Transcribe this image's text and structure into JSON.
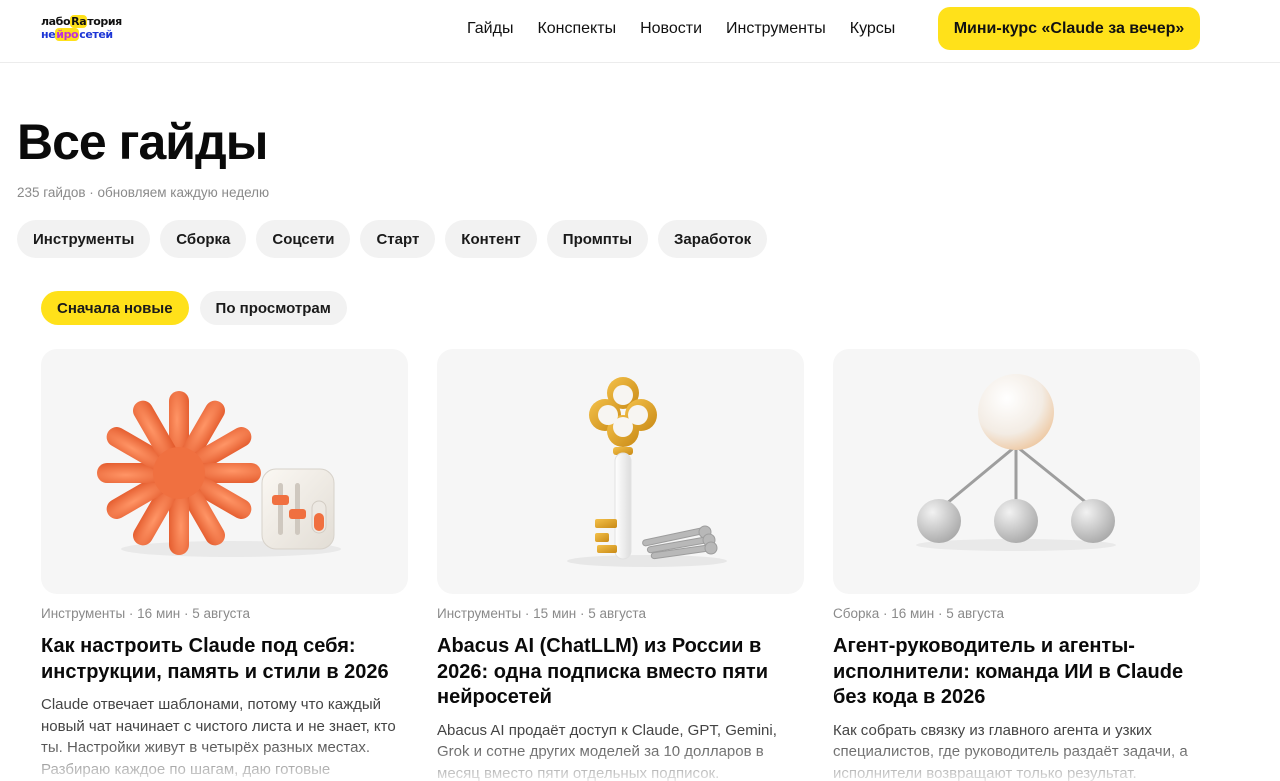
{
  "logo": {
    "line1_a": "лабо",
    "line1_b": "Ra",
    "line1_c": "тория",
    "line2_a": "не",
    "line2_b": "йро",
    "line2_c": "сетей"
  },
  "nav": {
    "items": [
      "Гайды",
      "Конспекты",
      "Новости",
      "Инструменты",
      "Курсы"
    ],
    "cta": "Мини-курс «Claude за вечер»"
  },
  "page": {
    "title": "Все гайды",
    "subtitle": "235 гайдов · обновляем каждую неделю"
  },
  "categories": [
    "Инструменты",
    "Сборка",
    "Соцсети",
    "Старт",
    "Контент",
    "Промпты",
    "Заработок"
  ],
  "sort": {
    "options": [
      "Сначала новые",
      "По просмотрам"
    ],
    "active": "Сначала новые"
  },
  "colors": {
    "accent": "#ffe11a",
    "orange": "#f0713f",
    "gold": "#e2a325"
  },
  "cards": [
    {
      "meta": "Инструменты · 16 мин · 5 августа",
      "title": "Как настроить Claude под себя: инструкции, память и стили в 2026",
      "desc": "Claude отвечает шаблонами, потому что каждый новый чат начинает с чистого листа и не знает, кто ты. Настройки живут в четырёх разных местах. Разбираю каждое по шагам, даю готовые",
      "image_icon": "asterisk-sliders-icon"
    },
    {
      "meta": "Инструменты · 15 мин · 5 августа",
      "title": "Abacus AI (ChatLLM) из России в 2026: одна подписка вместо пяти нейросетей",
      "desc": "Abacus AI продаёт доступ к Claude, GPT, Gemini, Grok и сотне других моделей за 10 долларов в месяц вместо пяти отдельных подписок.",
      "image_icon": "golden-key-icon"
    },
    {
      "meta": "Сборка · 16 мин · 5 августа",
      "title": "Агент-руководитель и агенты-исполнители: команда ИИ в Claude без кода в 2026",
      "desc": "Как собрать связку из главного агента и узких специалистов, где руководитель раздаёт задачи, а исполнители возвращают только результат.",
      "image_icon": "agent-tree-icon"
    }
  ]
}
